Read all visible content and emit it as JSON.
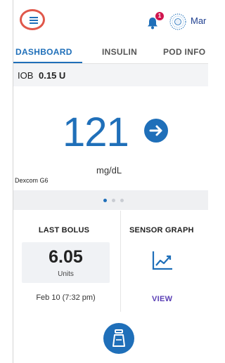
{
  "header": {
    "menu_icon": "hamburger-menu-icon",
    "notification_icon": "bell-icon",
    "notification_count": "1",
    "pod_icon": "pod-status-icon",
    "user_label": "Mar"
  },
  "tabs": [
    {
      "label": "DASHBOARD",
      "active": true
    },
    {
      "label": "INSULIN",
      "active": false
    },
    {
      "label": "POD INFO",
      "active": false
    }
  ],
  "iob": {
    "label": "IOB",
    "value": "0.15 U"
  },
  "glucose": {
    "value": "121",
    "unit": "mg/dL",
    "sensor": "Dexcom G6",
    "trend_icon": "arrow-right-icon"
  },
  "pager": {
    "count": 3,
    "active_index": 0
  },
  "last_bolus": {
    "title": "LAST BOLUS",
    "amount": "6.05",
    "unit": "Units",
    "time": "Feb 10 (7:32 pm)"
  },
  "sensor_graph": {
    "title": "SENSOR GRAPH",
    "icon": "line-graph-icon",
    "action": "VIEW"
  },
  "fab": {
    "icon": "pod-bolus-icon"
  },
  "colors": {
    "primary": "#1f6fb9",
    "badge": "#d0164e",
    "highlight_ring": "#e0574a",
    "link": "#5a3fb5"
  }
}
